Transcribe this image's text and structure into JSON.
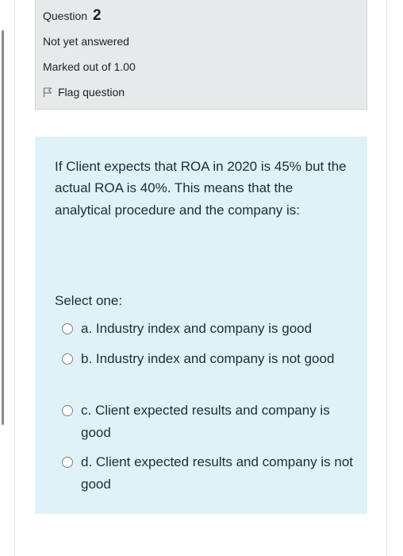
{
  "question": {
    "label": "Question",
    "number": "2",
    "state": "Not yet answered",
    "grade": "Marked out of 1.00",
    "flag_label": "Flag question",
    "flag_icon": "flag-icon"
  },
  "content": {
    "text": "If Client expects that ROA in 2020 is 45% but the actual ROA is 40%. This means that the analytical procedure and the company is:",
    "prompt": "Select one:",
    "options": [
      {
        "label": "a. Industry index and company is good"
      },
      {
        "label": "b. Industry index and company is not good"
      },
      {
        "label": "c. Client expected results and company is good"
      },
      {
        "label": "d. Client expected results and company is not good"
      }
    ]
  },
  "colors": {
    "info_background": "#e8e9eb",
    "content_background": "#def2f8",
    "text": "#1f2d3a"
  }
}
